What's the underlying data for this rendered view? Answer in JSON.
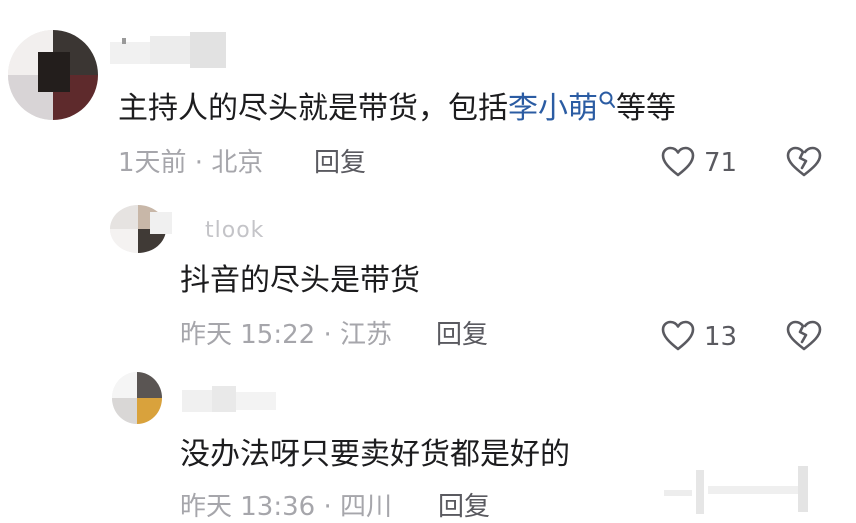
{
  "comments": [
    {
      "username": "",
      "text": "主持人的尽头就是带货，包括",
      "mention": "李小萌",
      "text_after": "等等",
      "time_location": "1天前 · 北京",
      "reply_label": "回复",
      "likes": "71"
    },
    {
      "username": "tlook",
      "text": "抖音的尽头是带货",
      "time_location": "昨天 15:22 · 江苏",
      "reply_label": "回复",
      "likes": "13"
    },
    {
      "username": "",
      "text": "没办法呀只要卖好货都是好的",
      "time_location": "昨天 13:36 · 四川",
      "reply_label": "回复"
    }
  ],
  "icons": {
    "search": "search-icon",
    "like": "heart-icon",
    "dislike": "broken-heart-icon"
  },
  "colors": {
    "mention": "#2b5ca3",
    "meta": "#a6a6ab",
    "text": "#1c1c1e"
  }
}
